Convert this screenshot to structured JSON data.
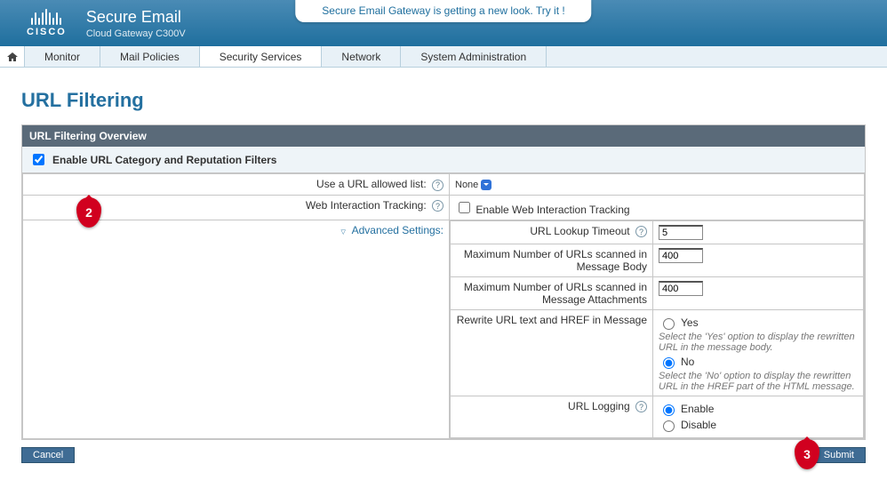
{
  "header": {
    "brand_word": "CISCO",
    "product": "Secure Email",
    "subproduct": "Cloud Gateway C300V",
    "promo": "Secure Email Gateway is getting a new look. Try it !"
  },
  "nav": {
    "items": [
      "Monitor",
      "Mail Policies",
      "Security Services",
      "Network",
      "System Administration"
    ],
    "active_index": 2
  },
  "page": {
    "title": "URL Filtering",
    "panel_title": "URL Filtering Overview",
    "enable_label": "Enable URL Category and Reputation Filters",
    "enable_checked": true,
    "rows": {
      "allowed_list_label": "Use a URL allowed list:",
      "allowed_list_value": "None",
      "web_track_label": "Web Interaction Tracking:",
      "web_track_cb_label": "Enable Web Interaction Tracking",
      "advanced_label": "Advanced Settings:"
    },
    "advanced": {
      "lookup_timeout_label": "URL Lookup Timeout",
      "lookup_timeout_value": "5",
      "max_body_label": "Maximum Number of URLs scanned in Message Body",
      "max_body_value": "400",
      "max_attach_label": "Maximum Number of URLs scanned in Message Attachments",
      "max_attach_value": "400",
      "rewrite_label": "Rewrite URL text and HREF in Message",
      "rewrite_yes": "Yes",
      "rewrite_yes_hint": "Select the 'Yes' option to display the rewritten URL in the message body.",
      "rewrite_no": "No",
      "rewrite_no_hint": "Select the 'No' option to display the rewritten URL in the HREF part of the HTML message.",
      "logging_label": "URL Logging",
      "logging_enable": "Enable",
      "logging_disable": "Disable"
    },
    "buttons": {
      "cancel": "Cancel",
      "submit": "Submit"
    },
    "callouts": {
      "c2": "2",
      "c3": "3"
    }
  }
}
